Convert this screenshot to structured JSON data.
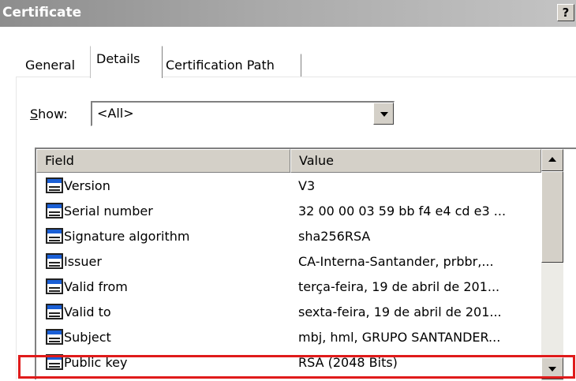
{
  "window": {
    "title": "Certificate",
    "help_label": "?"
  },
  "tabs": [
    {
      "label": "General"
    },
    {
      "label": "Details"
    },
    {
      "label": "Certification Path"
    }
  ],
  "show": {
    "label_prefix": "S",
    "label_rest": "how:",
    "selected": "<All>"
  },
  "list": {
    "columns": {
      "field": "Field",
      "value": "Value"
    },
    "rows": [
      {
        "field": "Version",
        "value": "V3"
      },
      {
        "field": "Serial number",
        "value": "32 00 00 03 59 bb f4 e4 cd e3 ..."
      },
      {
        "field": "Signature algorithm",
        "value": "sha256RSA"
      },
      {
        "field": "Issuer",
        "value": "CA-Interna-Santander, prbbr,..."
      },
      {
        "field": "Valid from",
        "value": "terça-feira, 19 de abril de 201..."
      },
      {
        "field": "Valid to",
        "value": "sexta-feira, 19 de abril de 201..."
      },
      {
        "field": "Subject",
        "value": "mbj, hml, GRUPO SANTANDER..."
      },
      {
        "field": "Public key",
        "value": "RSA (2048 Bits)"
      }
    ]
  },
  "icons": {
    "row": "certificate-field-icon",
    "scroll_up": "scroll-up-arrow-icon",
    "scroll_down": "scroll-down-arrow-icon",
    "dropdown": "dropdown-arrow-icon"
  },
  "colors": {
    "highlight": "#e01b1b",
    "titlebar": "#a9a9a9",
    "icon_blue": "#1a5fd6"
  }
}
